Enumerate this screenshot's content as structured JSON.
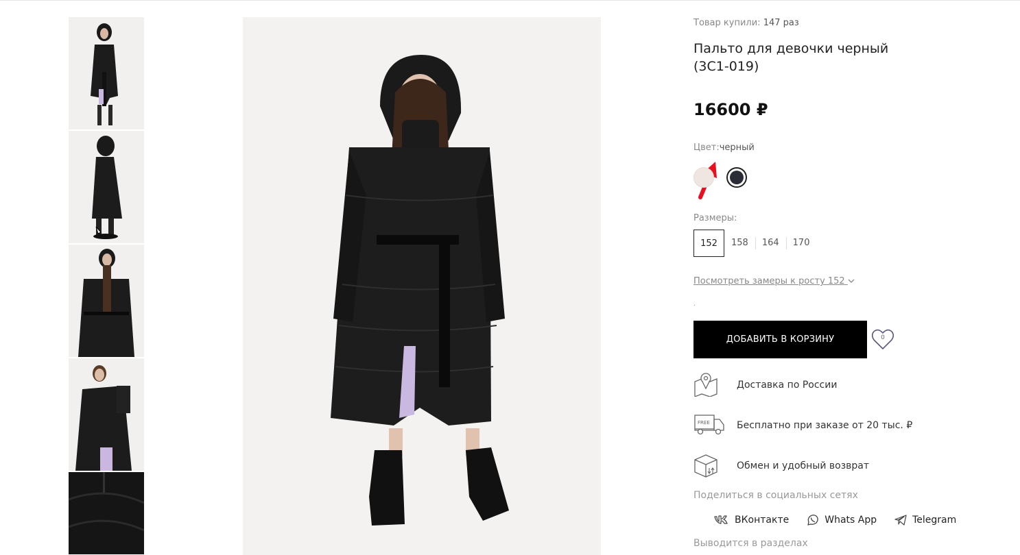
{
  "product": {
    "bought_label": "Товар купили:",
    "bought_count": "147 раз",
    "title": "Пальто для девочки черный (3С1-019)",
    "price": "16600 ₽"
  },
  "color": {
    "label": "Цвет:",
    "value": "черный",
    "swatches": [
      {
        "name": "beige",
        "hex": "#efe6e1"
      },
      {
        "name": "black",
        "hex": "#2a2d36",
        "selected": true
      }
    ]
  },
  "sizes": {
    "label": "Размеры:",
    "options": [
      "152",
      "158",
      "164",
      "170"
    ],
    "selected": "152"
  },
  "measure_link": "Посмотреть замеры к росту 152",
  "dot": ".",
  "cart_button": "ДОБАВИТЬ В КОРЗИНУ",
  "favorites_count": "0",
  "features": [
    {
      "icon": "map-pin-icon",
      "text": "Доставка по России"
    },
    {
      "icon": "free-truck-icon",
      "text": "Бесплатно при заказе от 20 тыс. ₽"
    },
    {
      "icon": "box-exchange-icon",
      "text": "Обмен и удобный возврат"
    }
  ],
  "share": {
    "label": "Поделиться в социальных сетях",
    "links": [
      {
        "icon": "vk-icon",
        "label": "ВКонтакте"
      },
      {
        "icon": "whatsapp-icon",
        "label": "Whats App"
      },
      {
        "icon": "telegram-icon",
        "label": "Telegram"
      }
    ]
  },
  "sections_label": "Выводится в разделах",
  "colors": {
    "accent_arrow": "#e8101e",
    "button_bg": "#000000",
    "muted_text": "#888888"
  }
}
